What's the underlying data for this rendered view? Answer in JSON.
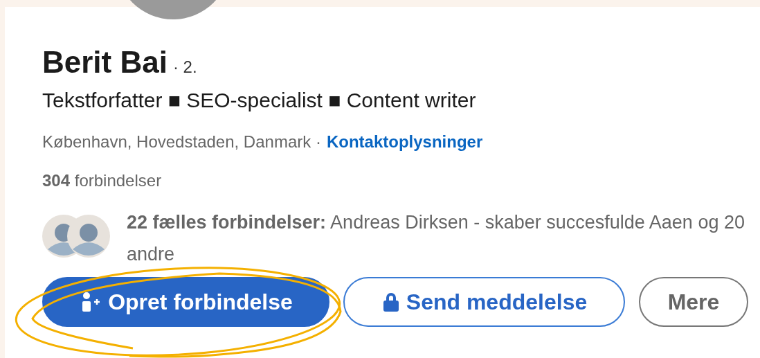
{
  "profile": {
    "name": "Berit Bai",
    "degree": "· 2.",
    "headline": "Tekstforfatter ■ SEO-specialist ■ Content writer",
    "location": "København, Hovedstaden, Danmark ·",
    "contact_link": "Kontaktoplysninger",
    "connections": "**304** forbindelser",
    "mutual": "**22 fælles forbindelser:** Andreas Dirksen - skaber succesfulde Aaen og 20 andre"
  },
  "buttons": [
    {
      "kind": "primary",
      "label": "Opret forbindelse"
    },
    {
      "kind": "secondary",
      "label": "Send meddelelse"
    },
    {
      "kind": "neutral",
      "label": "Mere"
    }
  ]
}
